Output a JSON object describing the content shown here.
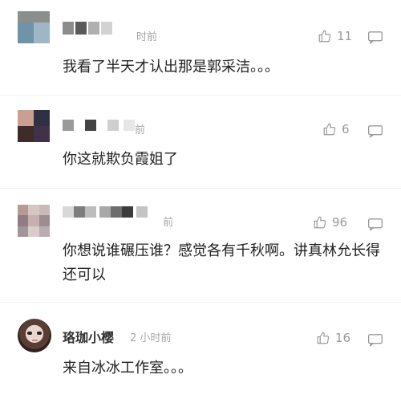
{
  "comments": [
    {
      "time": "时前",
      "likes": "11",
      "text": "我看了半天才认出那是郭采洁。。。"
    },
    {
      "time": "前",
      "likes": "6",
      "text": "你这就欺负霞姐了"
    },
    {
      "time": "前",
      "likes": "96",
      "text": "你想说谁碾压谁？感觉各有千秋啊。讲真林允长得还可以"
    },
    {
      "username": "珞珈小樱",
      "time": "2 小时前",
      "likes": "16",
      "text": "来自冰冰工作室。。。"
    }
  ],
  "icons": {
    "like": "thumbs-up-icon",
    "reply": "comment-bubble-icon"
  },
  "colors": {
    "meta": "#a6a6a6",
    "text": "#222222",
    "divider": "#ececec"
  }
}
